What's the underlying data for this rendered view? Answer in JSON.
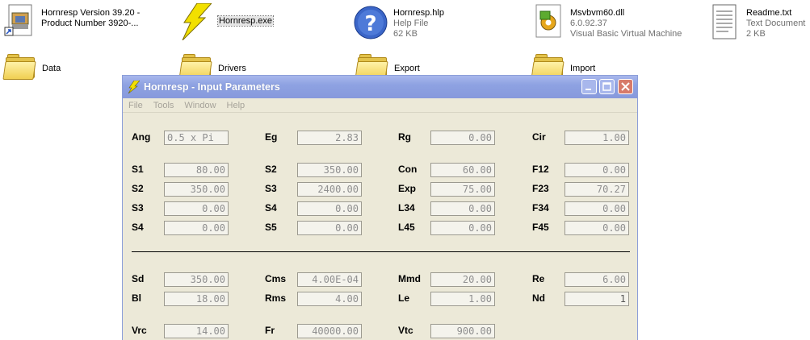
{
  "desktop": {
    "files": [
      {
        "id": "hornresp-shortcut",
        "line1": "Hornresp Version 39.20 -",
        "line2": "Product Number 3920-...",
        "line3": ""
      },
      {
        "id": "hornresp-exe",
        "line1": "Hornresp.exe",
        "line2": "",
        "line3": ""
      },
      {
        "id": "hornresp-hlp",
        "line1": "Hornresp.hlp",
        "line2": "Help File",
        "line3": "62 KB"
      },
      {
        "id": "msvbvm60",
        "line1": "Msvbvm60.dll",
        "line2": "6.0.92.37",
        "line3": "Visual Basic Virtual Machine"
      },
      {
        "id": "readme",
        "line1": "Readme.txt",
        "line2": "Text Document",
        "line3": "2 KB"
      }
    ],
    "folders": [
      "Data",
      "Drivers",
      "Export",
      "Import"
    ]
  },
  "window": {
    "title": "Hornresp - Input Parameters",
    "menu": [
      "File",
      "Tools",
      "Window",
      "Help"
    ],
    "buttons": {
      "min": "minimize",
      "max": "maximize",
      "close": "close"
    }
  },
  "params": {
    "row1": [
      [
        "Ang",
        "0.5 x Pi"
      ],
      [
        "Eg",
        "2.83"
      ],
      [
        "Rg",
        "0.00"
      ],
      [
        "Cir",
        "1.00"
      ]
    ],
    "row2": [
      [
        "S1",
        "80.00"
      ],
      [
        "S2",
        "350.00"
      ],
      [
        "Con",
        "60.00"
      ],
      [
        "F12",
        "0.00"
      ]
    ],
    "row3": [
      [
        "S2",
        "350.00"
      ],
      [
        "S3",
        "2400.00"
      ],
      [
        "Exp",
        "75.00"
      ],
      [
        "F23",
        "70.27"
      ]
    ],
    "row4": [
      [
        "S3",
        "0.00"
      ],
      [
        "S4",
        "0.00"
      ],
      [
        "L34",
        "0.00"
      ],
      [
        "F34",
        "0.00"
      ]
    ],
    "row5": [
      [
        "S4",
        "0.00"
      ],
      [
        "S5",
        "0.00"
      ],
      [
        "L45",
        "0.00"
      ],
      [
        "F45",
        "0.00"
      ]
    ],
    "row6": [
      [
        "Sd",
        "350.00"
      ],
      [
        "Cms",
        "4.00E-04"
      ],
      [
        "Mmd",
        "20.00"
      ],
      [
        "Re",
        "6.00"
      ]
    ],
    "row7": [
      [
        "Bl",
        "18.00"
      ],
      [
        "Rms",
        "4.00"
      ],
      [
        "Le",
        "1.00"
      ],
      [
        "Nd",
        "1"
      ]
    ],
    "row8": [
      [
        "Vrc",
        "14.00"
      ],
      [
        "Fr",
        "40000.00"
      ],
      [
        "Vtc",
        "900.00"
      ]
    ]
  },
  "colors": {
    "titlebar": "#8ea2e2",
    "window": "#ece9d8",
    "folder": "#f0cf52"
  }
}
